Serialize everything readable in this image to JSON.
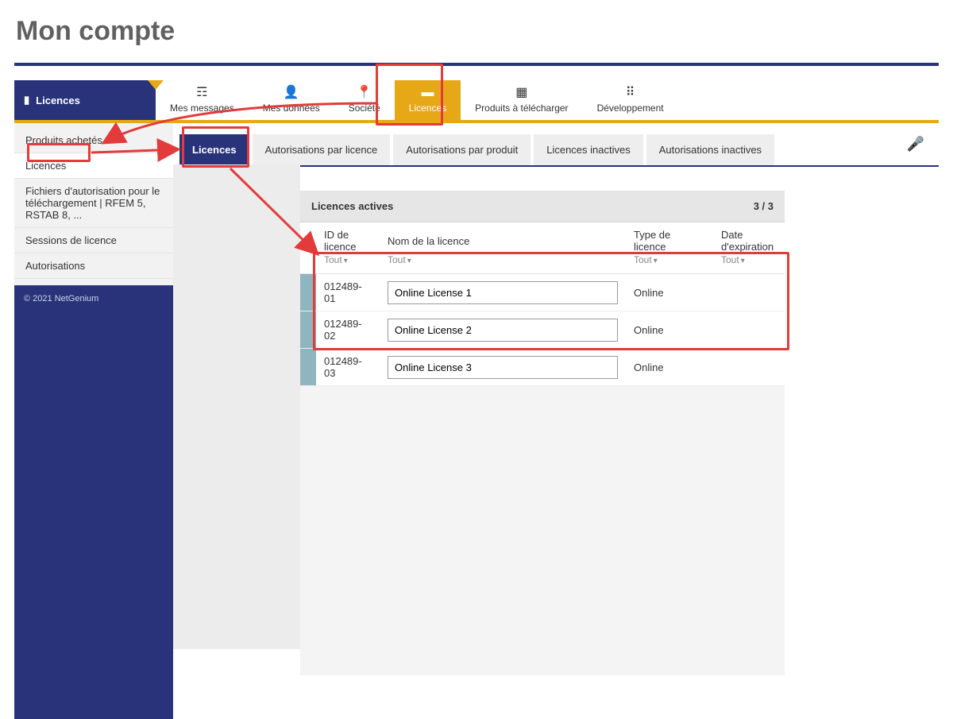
{
  "page": {
    "title": "Mon compte",
    "copyright": "© 2021 NetGenium"
  },
  "top_nav": {
    "current_label": "Licences",
    "items": [
      {
        "icon": "✉",
        "label": "Mes messages"
      },
      {
        "icon": "👤",
        "label": "Mes données"
      },
      {
        "icon": "📍",
        "label": "Société"
      },
      {
        "icon": "▮",
        "label": "Licences",
        "active": true
      },
      {
        "icon": "▦",
        "label": "Produits à télécharger"
      },
      {
        "icon": "⠿",
        "label": "Développement"
      }
    ]
  },
  "sidebar": {
    "items": [
      {
        "label": "Produits achetés"
      },
      {
        "label": "Licences",
        "active": true
      },
      {
        "label": "Fichiers d'autorisation pour le téléchargement | RFEM 5, RSTAB 8, ..."
      },
      {
        "label": "Sessions de licence"
      },
      {
        "label": "Autorisations"
      }
    ]
  },
  "tabs": {
    "items": [
      {
        "label": "Licences",
        "active": true
      },
      {
        "label": "Autorisations par licence"
      },
      {
        "label": "Autorisations par produit"
      },
      {
        "label": "Licences inactives"
      },
      {
        "label": "Autorisations inactives"
      }
    ]
  },
  "panel": {
    "title": "Licences actives",
    "count_label": "3 / 3",
    "columns": {
      "id": "ID de licence",
      "name": "Nom de la licence",
      "type": "Type de licence",
      "exp": "Date d'expiration"
    },
    "filter_all": "Tout",
    "rows": [
      {
        "id": "012489-01",
        "name": "Online License 1",
        "type": "Online",
        "exp": ""
      },
      {
        "id": "012489-02",
        "name": "Online License 2",
        "type": "Online",
        "exp": ""
      },
      {
        "id": "012489-03",
        "name": "Online License 3",
        "type": "Online",
        "exp": ""
      }
    ]
  }
}
